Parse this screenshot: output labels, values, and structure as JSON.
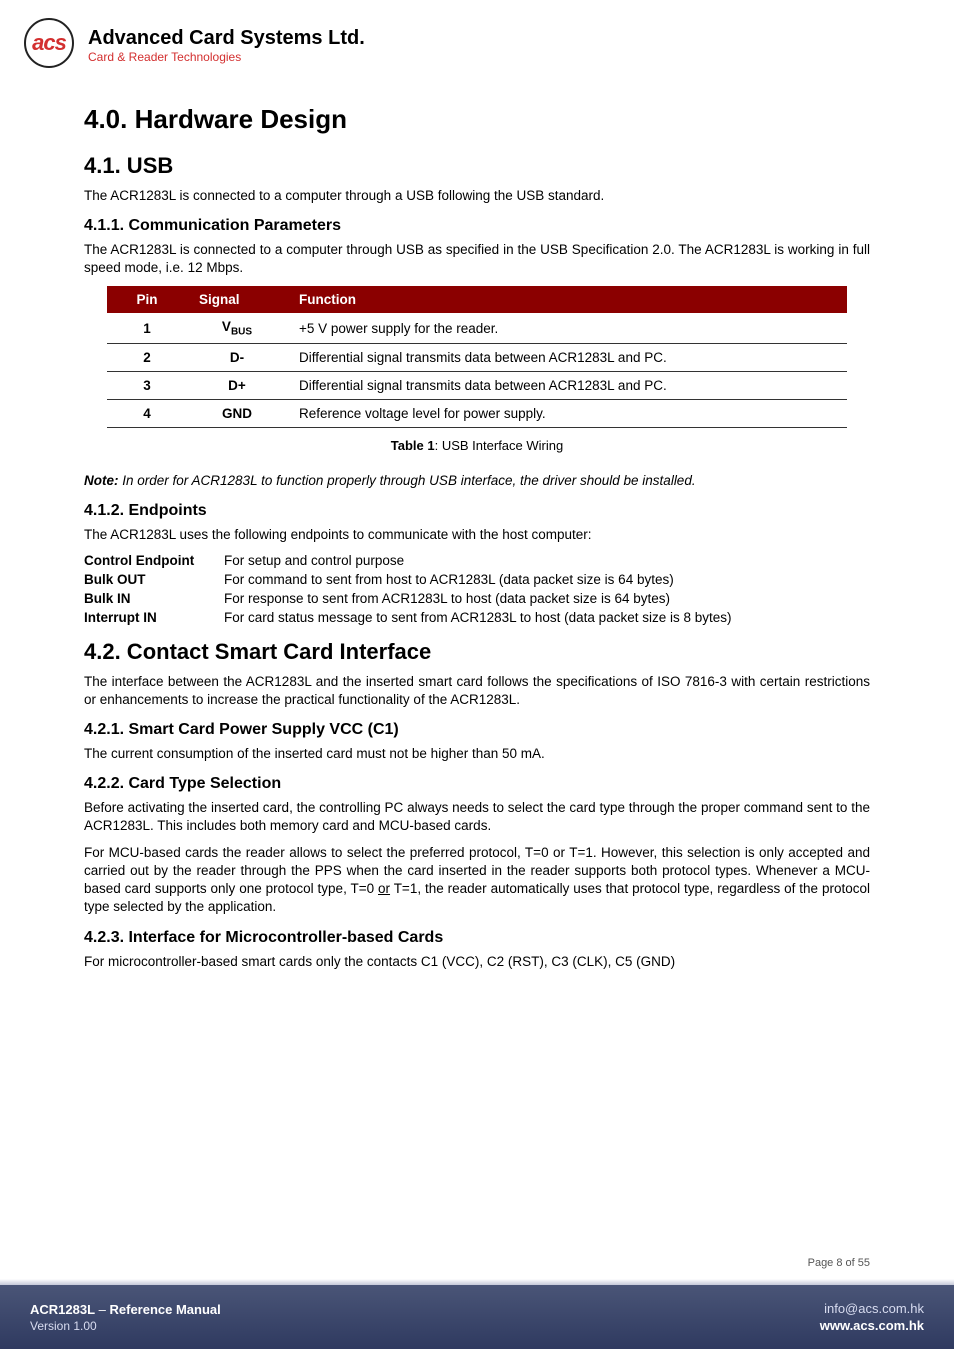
{
  "brand": {
    "logo_initials": "acs",
    "title": "Advanced Card Systems Ltd.",
    "subtitle": "Card & Reader Technologies"
  },
  "headings": {
    "h1": "4.0. Hardware Design",
    "h2_1": "4.1.   USB",
    "h3_1_1": "4.1.1.  Communication Parameters",
    "h3_1_2": "4.1.2.  Endpoints",
    "h2_2": "4.2.   Contact Smart Card Interface",
    "h3_2_1": "4.2.1.  Smart Card Power Supply VCC (C1)",
    "h3_2_2": "4.2.2.  Card Type Selection",
    "h3_2_3": "4.2.3.  Interface for Microcontroller-based Cards"
  },
  "paras": {
    "p_usb": "The ACR1283L is connected to a computer through a USB following the USB standard.",
    "p_comm": "The ACR1283L is connected to a computer through USB as specified in the USB Specification 2.0. The ACR1283L is working in full speed mode, i.e. 12 Mbps.",
    "table_caption_b": "Table 1",
    "table_caption_rest": ": USB Interface Wiring",
    "note_prefix": "Note:",
    "note_body": " In order for ACR1283L to function properly through USB interface, the driver should be installed.",
    "p_endpoints": "The ACR1283L uses the following endpoints to communicate with the host computer:",
    "p_contact": "The interface between the ACR1283L and the inserted smart card follows the specifications of ISO 7816-3 with certain restrictions or enhancements to increase the practical functionality of the ACR1283L.",
    "p_vcc": "The current consumption of the inserted card must not be higher than 50 mA.",
    "p_cardtype1": "Before activating the inserted card, the controlling PC always needs to select the card type through the proper command sent to the ACR1283L. This includes both memory card and MCU-based cards.",
    "p_cardtype2_a": "For MCU-based cards the reader allows to select the preferred protocol, T=0 or T=1. However, this selection is only accepted and carried out by the reader through the PPS when the card inserted in the reader supports both protocol types. Whenever a MCU-based card supports only one protocol type, T=0 ",
    "p_cardtype2_or": "or",
    "p_cardtype2_b": " T=1, the reader automatically uses that protocol type, regardless of the protocol type selected by the application.",
    "p_micro": "For microcontroller-based smart cards only the contacts C1 (VCC), C2 (RST), C3 (CLK), C5 (GND)"
  },
  "table": {
    "head": {
      "c1": "Pin",
      "c2": "Signal",
      "c3": "Function"
    },
    "rows": [
      {
        "pin": "1",
        "sig_pre": "V",
        "sig_sub": "BUS",
        "func": "+5 V power supply for the reader."
      },
      {
        "pin": "2",
        "sig": "D-",
        "func": "Differential signal transmits data between ACR1283L and PC."
      },
      {
        "pin": "3",
        "sig": "D+",
        "func": "Differential signal transmits data between ACR1283L and PC."
      },
      {
        "pin": "4",
        "sig": "GND",
        "func": "Reference voltage level for power supply."
      }
    ]
  },
  "endpoints": {
    "e1": {
      "term": "Control Endpoint",
      "def": "For setup and control purpose"
    },
    "e2": {
      "term": "Bulk OUT",
      "def": "For command to sent from host to ACR1283L (data packet size is 64 bytes)"
    },
    "e3": {
      "term": "Bulk IN",
      "def": "For response to sent from ACR1283L to host (data packet size is 64 bytes)"
    },
    "e4": {
      "term": "Interrupt IN",
      "def": "For card status message to sent from ACR1283L to host (data packet size is 8 bytes)"
    }
  },
  "footer": {
    "page": "Page 8 of 55",
    "manual_product": "ACR1283L",
    "manual_sep": " – ",
    "manual_name": "Reference Manual",
    "version": "Version 1.00",
    "email": "info@acs.com.hk",
    "website": "www.acs.com.hk"
  }
}
